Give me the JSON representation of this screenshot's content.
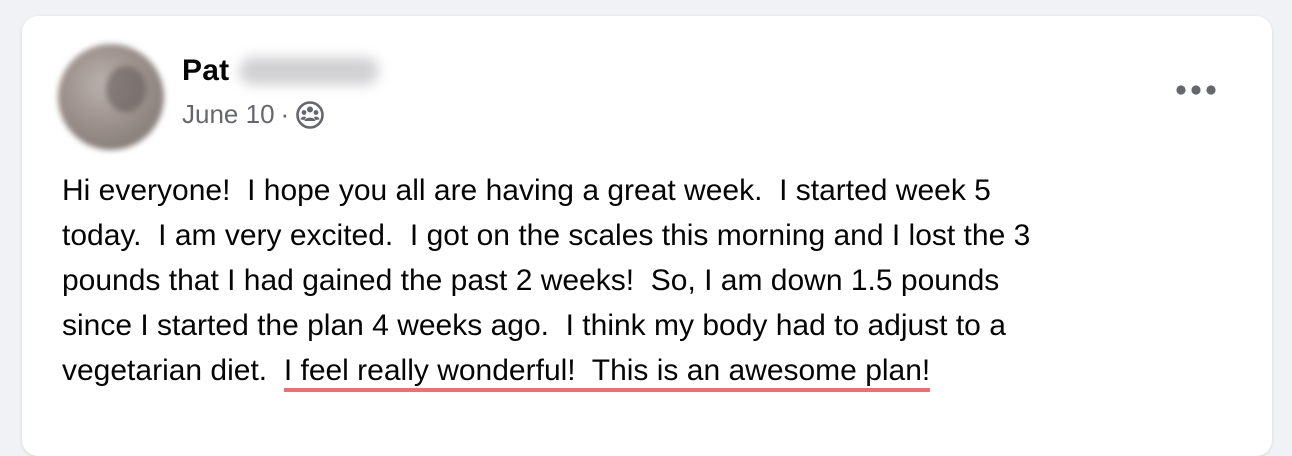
{
  "post": {
    "author_name": "Pat",
    "date": "June 10",
    "separator": "·",
    "audience_icon": "group-audience-icon",
    "more_icon": "more-options-icon",
    "text_lines": [
      "Hi everyone!  I hope you all are having a great week.  I started week 5",
      "today.  I am very excited.  I got on the scales this morning and I lost the 3",
      "pounds that I had gained the past 2 weeks!  So, I am down 1.5 pounds",
      "since I started the plan 4 weeks ago.  I think my body had to adjust to a"
    ],
    "last_line_prefix": "vegetarian diet.  ",
    "highlighted_text": "I feel really wonderful!  This is an awesome plan!",
    "highlight_color": "#ec7070"
  }
}
